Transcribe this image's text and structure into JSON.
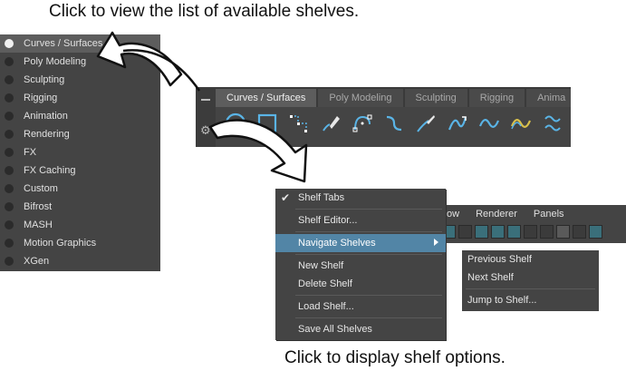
{
  "captions": {
    "top": "Click to view the list of available shelves.",
    "bottom": "Click to display shelf options."
  },
  "shelf_list": {
    "selected": "Curves / Surfaces",
    "items": [
      "Curves / Surfaces",
      "Poly Modeling",
      "Sculpting",
      "Rigging",
      "Animation",
      "Rendering",
      "FX",
      "FX Caching",
      "Custom",
      "Bifrost",
      "MASH",
      "Motion Graphics",
      "XGen"
    ]
  },
  "shelf_bar": {
    "tabs": [
      "Curves / Surfaces",
      "Poly Modeling",
      "Sculpting",
      "Rigging",
      "Anima"
    ],
    "active_tab": "Curves / Surfaces",
    "tool_icons": [
      "circle-curve-icon",
      "square-curve-icon",
      "cv-curve-icon",
      "pencil-curve-icon",
      "ep-curve-icon",
      "bezier-curve-icon",
      "sculpt-pen-icon",
      "arc-curve-icon",
      "sine-curve-icon",
      "yellow-curve-icon",
      "cluster-curve-icon"
    ]
  },
  "menubar": {
    "items": [
      "ow",
      "Renderer",
      "Panels"
    ]
  },
  "shelf_options_menu": {
    "items": [
      {
        "label": "Shelf Tabs",
        "checked": true
      },
      {
        "label": "Shelf Editor..."
      },
      {
        "label": "Navigate Shelves",
        "submenu": true,
        "highlighted": true
      },
      {
        "label": "New Shelf"
      },
      {
        "label": "Delete Shelf"
      },
      {
        "label": "Load Shelf..."
      },
      {
        "label": "Save All Shelves"
      }
    ]
  },
  "navigate_submenu": {
    "items": [
      "Previous Shelf",
      "Next Shelf",
      "Jump to Shelf..."
    ]
  },
  "colors": {
    "panel_bg": "#444444",
    "highlight": "#5285a6",
    "tool_blue": "#5ab4e6",
    "tool_yellow": "#d9c04a"
  }
}
